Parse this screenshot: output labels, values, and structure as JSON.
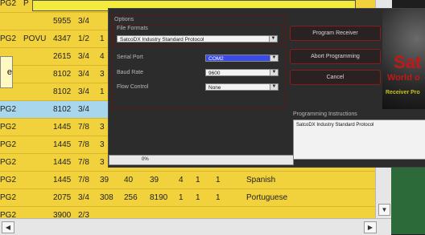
{
  "table": {
    "rows": [
      {
        "c0": "PG2",
        "c1": "P",
        "c2": "",
        "c3": "",
        "c4": "",
        "c5": "",
        "c6": "",
        "c7": "",
        "c8": "",
        "c9": "",
        "c10": "",
        "c11": ""
      },
      {
        "c0": "",
        "c1": "",
        "c2": "5955",
        "c3": "3/4",
        "c4": "",
        "c5": "",
        "c6": "",
        "c7": "",
        "c8": "",
        "c9": "",
        "c10": "",
        "c11": ""
      },
      {
        "c0": "PG2",
        "c1": "POVU",
        "c2": "4347",
        "c3": "1/2",
        "c4": "1",
        "c5": "",
        "c6": "",
        "c7": "",
        "c8": "",
        "c9": "",
        "c10": "",
        "c11": ""
      },
      {
        "c0": "",
        "c1": "",
        "c2": "2615",
        "c3": "3/4",
        "c4": "4",
        "c5": "",
        "c6": "",
        "c7": "",
        "c8": "",
        "c9": "",
        "c10": "",
        "c11": ""
      },
      {
        "c0": "",
        "c1": "",
        "c2": "8102",
        "c3": "3/4",
        "c4": "3",
        "c5": "",
        "c6": "",
        "c7": "",
        "c8": "",
        "c9": "",
        "c10": "",
        "c11": ""
      },
      {
        "c0": "",
        "c1": "",
        "c2": "8102",
        "c3": "3/4",
        "c4": "1",
        "c5": "",
        "c6": "",
        "c7": "",
        "c8": "",
        "c9": "",
        "c10": "",
        "c11": ""
      },
      {
        "c0": "PG2",
        "c1": "",
        "c2": "8102",
        "c3": "3/4",
        "c4": "",
        "c5": "",
        "c6": "",
        "c7": "",
        "c8": "",
        "c9": "",
        "c10": "",
        "c11": ""
      },
      {
        "c0": "PG2",
        "c1": "",
        "c2": "1445",
        "c3": "7/8",
        "c4": "3",
        "c5": "",
        "c6": "",
        "c7": "",
        "c8": "",
        "c9": "",
        "c10": "",
        "c11": ""
      },
      {
        "c0": "PG2",
        "c1": "",
        "c2": "1445",
        "c3": "7/8",
        "c4": "3",
        "c5": "",
        "c6": "",
        "c7": "",
        "c8": "",
        "c9": "",
        "c10": "",
        "c11": ""
      },
      {
        "c0": "PG2",
        "c1": "",
        "c2": "1445",
        "c3": "7/8",
        "c4": "3",
        "c5": "",
        "c6": "",
        "c7": "",
        "c8": "",
        "c9": "",
        "c10": "",
        "c11": ""
      },
      {
        "c0": "PG2",
        "c1": "",
        "c2": "1445",
        "c3": "7/8",
        "c4": "39",
        "c5": "40",
        "c6": "39",
        "c7": "4",
        "c8": "1",
        "c9": "1",
        "c10": "Spanish",
        "c11": ""
      },
      {
        "c0": "PG2",
        "c1": "",
        "c2": "2075",
        "c3": "3/4",
        "c4": "308",
        "c5": "256",
        "c6": "8190",
        "c7": "1",
        "c8": "1",
        "c9": "1",
        "c10": "Portuguese",
        "c11": ""
      },
      {
        "c0": "PG2",
        "c1": "",
        "c2": "3900",
        "c3": "2/3",
        "c4": "",
        "c5": "",
        "c6": "",
        "c7": "",
        "c8": "",
        "c9": "",
        "c10": "",
        "c11": ""
      }
    ],
    "selected_row": 6
  },
  "tooltip_left": "e",
  "programmer": {
    "options_label": "Options",
    "file_formats_label": "File Formats",
    "file_format_value": "SatcoDX Industry Standard Protocol",
    "serial_port_label": "Serial Port",
    "serial_port_value": "COM2",
    "baud_rate_label": "Baud Rate",
    "baud_rate_value": "9600",
    "flow_control_label": "Flow Control",
    "flow_control_value": "None",
    "program_button": "Program Receiver",
    "abort_button": "Abort Programming",
    "cancel_button": "Cancel",
    "instructions_label": "Programming Instructions",
    "instructions_text": "SatcoDX Industry Standard Protocol",
    "progress_text": "0%",
    "progress_fraction": 0
  },
  "logo": {
    "line1": "Sat",
    "line2": "World o",
    "line3": "Receiver Pro"
  }
}
